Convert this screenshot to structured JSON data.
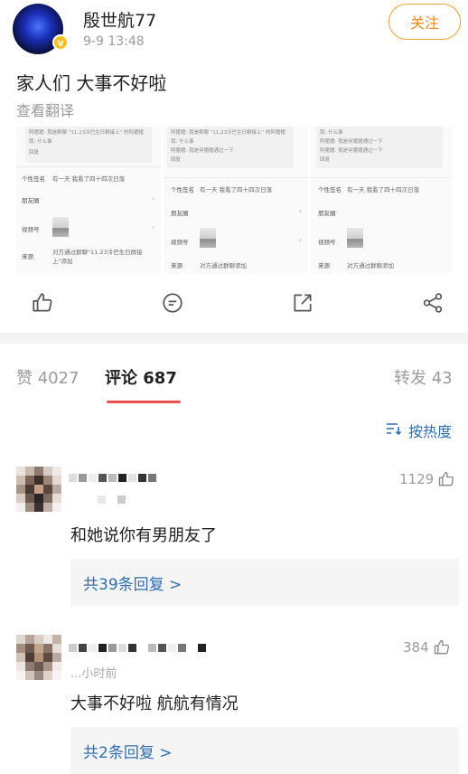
{
  "post": {
    "username": "殷世航77",
    "time": "9-9 13:48",
    "follow_label": "关注",
    "verified_mark": "v",
    "text": "家人们 大事不好啦",
    "translate_label": "查看翻译"
  },
  "screenshots": [
    {
      "chat_lines": [
        "阿猪猪: 我是群聊 \"11.23冷巴生日群接上\" 的阿猪猪",
        "我: 什么事"
      ],
      "chat_tag": "回复",
      "rows": [
        {
          "label": "个性签名",
          "value": "有一天 我看了四十四次日落"
        },
        {
          "label": "朋友圈",
          "value": ""
        },
        {
          "label": "视频号",
          "value": ""
        },
        {
          "label": "来源",
          "value": "对方通过群聊\"11.23冷巴生日群接上\"添加"
        }
      ]
    },
    {
      "chat_lines": [
        "阿猪猪: 我是群聊 \"11.23冷巴生日群接上\" 的阿猪猪",
        "我: 什么事",
        "阿猪猪: 我是何猪猪通过一下"
      ],
      "chat_tag": "回复",
      "rows": [
        {
          "label": "个性签名",
          "value": "有一天 我看了四十四次日落"
        },
        {
          "label": "朋友圈",
          "value": ""
        },
        {
          "label": "视频号",
          "value": ""
        },
        {
          "label": "来源",
          "value": "对方通过群聊添加"
        }
      ]
    },
    {
      "chat_lines": [
        "我: 什么事",
        "阿猪猪: 我是何猪猪通过一下",
        "阿猪猪: 我是何猪猪通过一下"
      ],
      "chat_tag": "回复",
      "rows": [
        {
          "label": "个性签名",
          "value": "有一天 我看了四十四次日落"
        },
        {
          "label": "朋友圈",
          "value": ""
        },
        {
          "label": "视频号",
          "value": ""
        },
        {
          "label": "来源",
          "value": "对方通过群聊添加"
        }
      ]
    }
  ],
  "actions": {
    "icons": [
      "like-icon",
      "comment-icon",
      "share-icon",
      "more-share-icon"
    ]
  },
  "tabs": {
    "likes": "赞 4027",
    "comments": "评论 687",
    "reposts": "转发 43"
  },
  "sort": {
    "label": "按热度",
    "icon": "sort-icon"
  },
  "comments": [
    {
      "likes": "1129",
      "text": "和她说你有男朋友了",
      "replies": "共39条回复 >"
    },
    {
      "likes": "384",
      "time": "...小时前",
      "text": "大事不好啦 航航有情况",
      "replies": "共2条回复 >"
    }
  ],
  "colors": {
    "accent_orange": "#f08a1a",
    "link_blue": "#2f6fb0",
    "tab_underline": "#e8534f",
    "badge_gold": "#f6c223"
  }
}
